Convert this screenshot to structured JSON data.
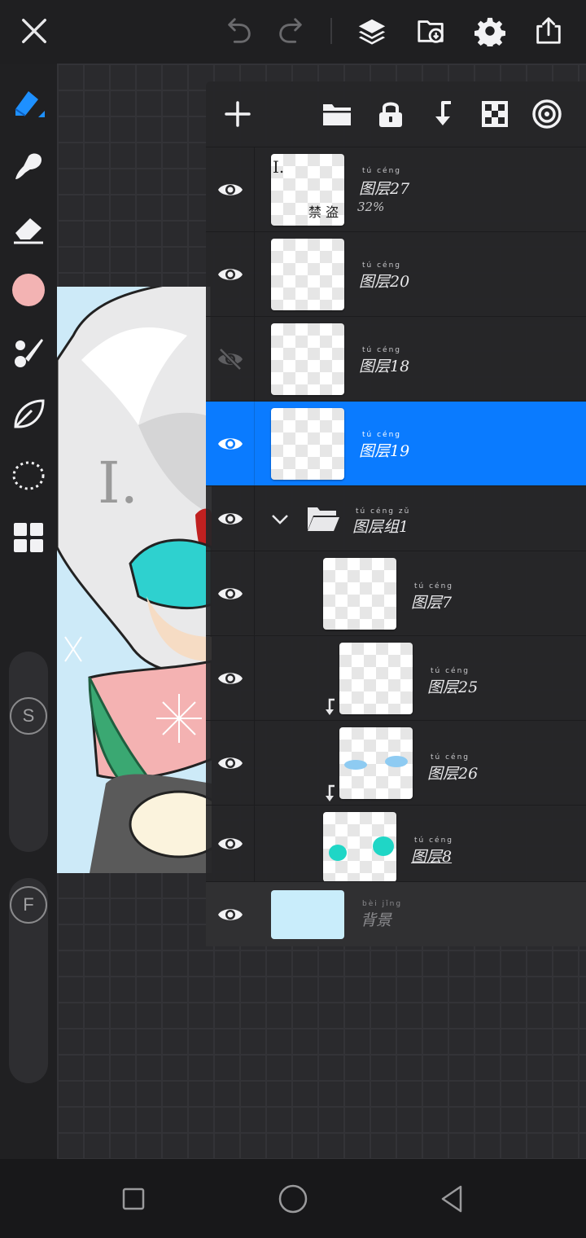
{
  "colors": {
    "accent": "#0a7bff",
    "brush_color": "#f3b3b3",
    "background_layer": "#c9edfb"
  },
  "topbar": {
    "icons": [
      "close-icon",
      "undo-icon",
      "redo-icon",
      "layers-icon",
      "import-icon",
      "settings-icon",
      "export-icon"
    ]
  },
  "left_toolbar": {
    "tools": [
      "pen-icon",
      "smudge-icon",
      "eraser-icon",
      "color-swatch",
      "brush-icon",
      "fill-icon",
      "lasso-icon",
      "grid-icon"
    ],
    "size_slider_label": "S",
    "opacity_slider_label": "F"
  },
  "layers_panel": {
    "toolbar_icons": [
      "add-layer-icon",
      "folder-icon",
      "lock-icon",
      "merge-down-icon",
      "checker-icon",
      "blend-icon"
    ],
    "layers": [
      {
        "name": "图层27",
        "ruby": "tú céng",
        "opacity": "32%",
        "visible": true,
        "selected": false
      },
      {
        "name": "图层20",
        "ruby": "tú céng",
        "visible": true,
        "selected": false
      },
      {
        "name": "图层18",
        "ruby": "tú céng",
        "visible": false,
        "selected": false
      },
      {
        "name": "图层19",
        "ruby": "tú céng",
        "visible": true,
        "selected": true
      },
      {
        "name": "图层组1",
        "ruby": "tú céng zǔ",
        "visible": true,
        "is_group": true
      },
      {
        "name": "图层7",
        "ruby": "tú céng",
        "visible": true
      },
      {
        "name": "图层25",
        "ruby": "tú céng",
        "visible": true,
        "clipped": true
      },
      {
        "name": "图层26",
        "ruby": "tú céng",
        "visible": true,
        "clipped": true
      },
      {
        "name": "图层8",
        "ruby": "tú céng",
        "visible": true
      },
      {
        "name": "背景",
        "ruby": "bèi jǐng",
        "visible": true,
        "is_background": true
      }
    ],
    "thumb_text_27_a": "I.",
    "thumb_text_27_b": "禁 盗"
  },
  "navbar": {
    "icons": [
      "recent-apps-icon",
      "home-icon",
      "back-icon"
    ]
  }
}
